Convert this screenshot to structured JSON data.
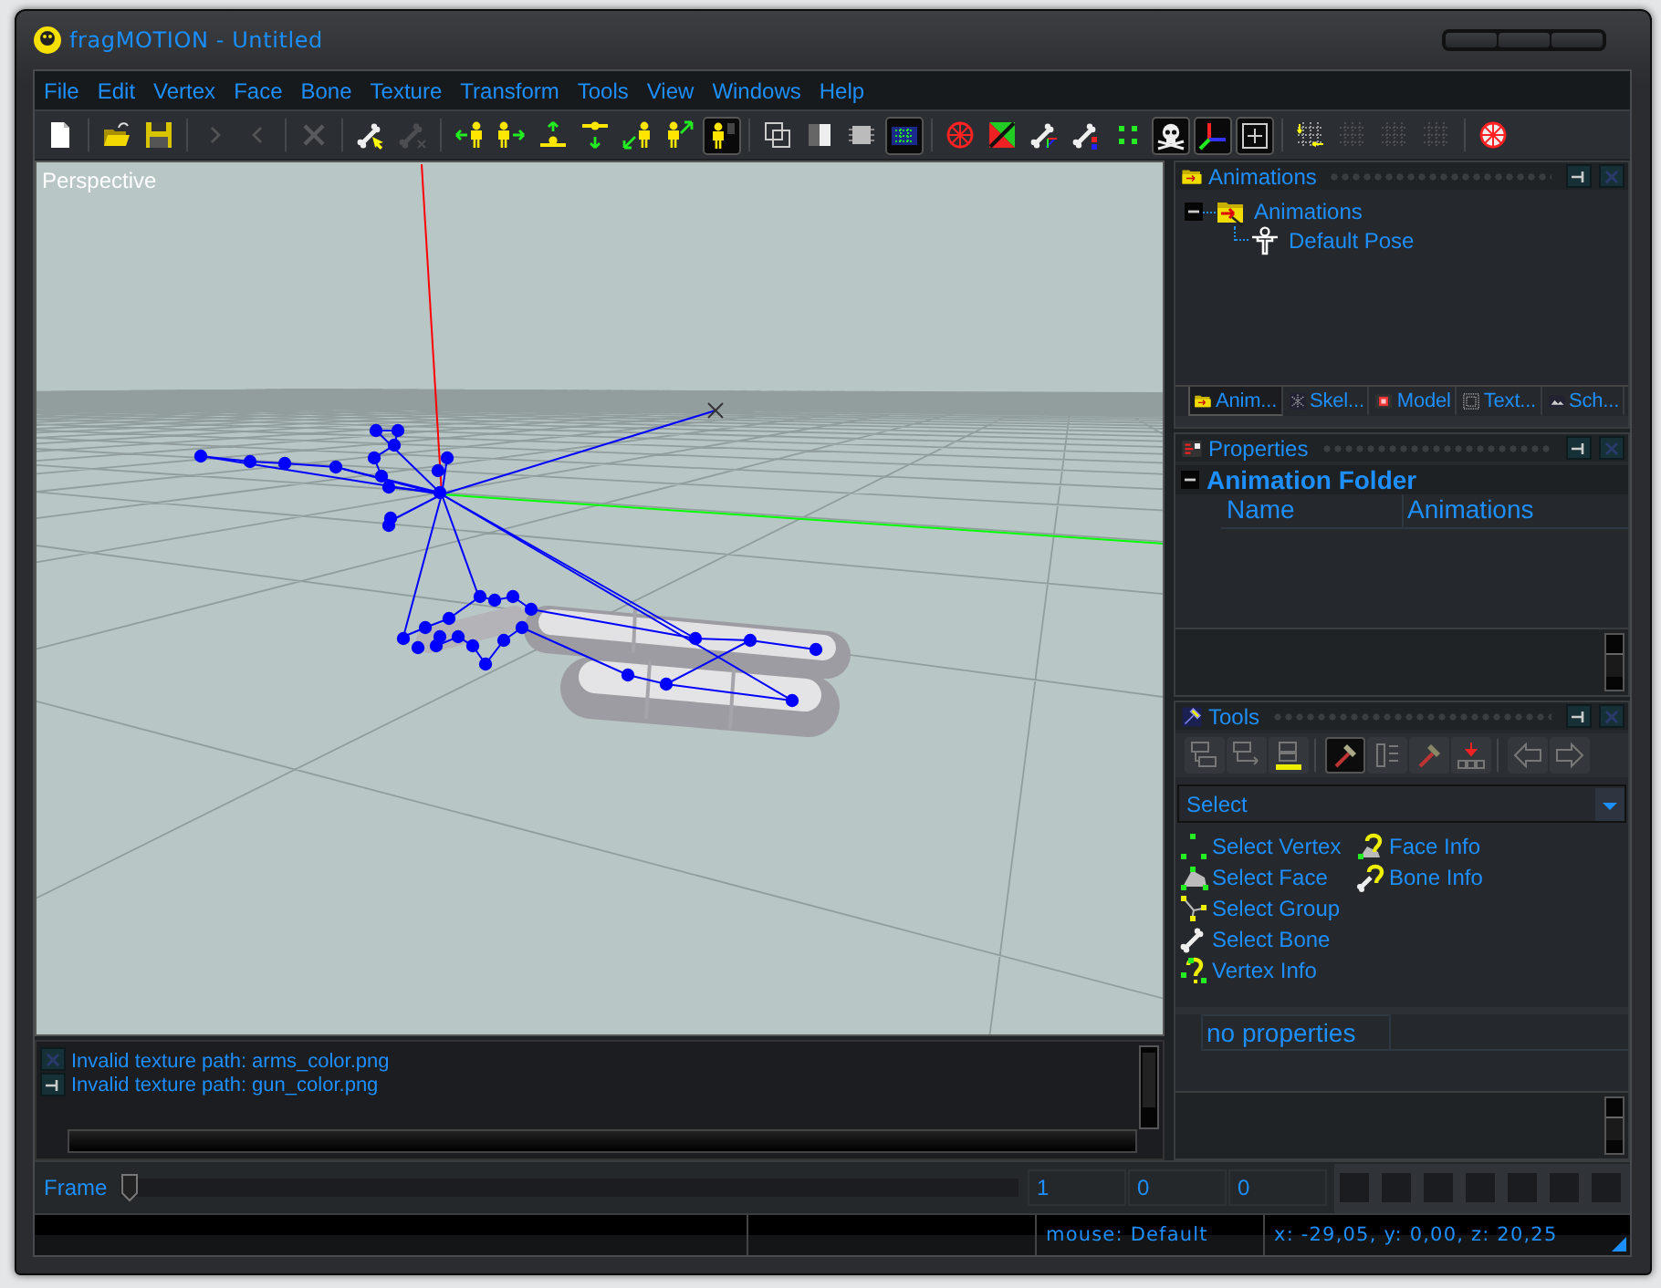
{
  "window": {
    "title": "fragMOTION - Untitled"
  },
  "menu": [
    "File",
    "Edit",
    "Vertex",
    "Face",
    "Bone",
    "Texture",
    "Transform",
    "Tools",
    "View",
    "Windows",
    "Help"
  ],
  "toolbar_groups": [
    [
      {
        "pressed": false,
        "disabled": false
      }
    ],
    [
      {
        "pressed": false,
        "disabled": false
      },
      {
        "pressed": false,
        "disabled": false
      }
    ],
    [
      {
        "pressed": false,
        "disabled": true
      },
      {
        "pressed": false,
        "disabled": true
      }
    ],
    [
      {
        "pressed": false,
        "disabled": true
      }
    ],
    [
      {
        "pressed": false,
        "disabled": false
      },
      {
        "pressed": false,
        "disabled": true
      }
    ],
    [
      {
        "pressed": false,
        "disabled": false
      },
      {
        "pressed": false,
        "disabled": false
      },
      {
        "pressed": false,
        "disabled": false
      },
      {
        "pressed": false,
        "disabled": false
      },
      {
        "pressed": false,
        "disabled": false
      },
      {
        "pressed": false,
        "disabled": false
      },
      {
        "pressed": true,
        "disabled": false
      }
    ],
    [
      {
        "pressed": false,
        "disabled": false
      },
      {
        "pressed": false,
        "disabled": false
      },
      {
        "pressed": false,
        "disabled": false
      },
      {
        "pressed": true,
        "disabled": false
      }
    ],
    [
      {
        "pressed": false,
        "disabled": false
      },
      {
        "pressed": false,
        "disabled": false
      },
      {
        "pressed": false,
        "disabled": false
      },
      {
        "pressed": false,
        "disabled": false
      },
      {
        "pressed": false,
        "disabled": false
      },
      {
        "pressed": true,
        "disabled": false
      },
      {
        "pressed": true,
        "disabled": false
      },
      {
        "pressed": true,
        "disabled": false
      }
    ],
    [
      {
        "pressed": false,
        "disabled": false
      },
      {
        "pressed": false,
        "disabled": true
      },
      {
        "pressed": false,
        "disabled": true
      },
      {
        "pressed": false,
        "disabled": true
      }
    ],
    [
      {
        "pressed": false,
        "disabled": false
      }
    ]
  ],
  "viewport": {
    "label": "Perspective"
  },
  "animations_panel": {
    "title": "Animations",
    "tree": [
      {
        "label": "Animations",
        "expanded": true,
        "children": [
          {
            "label": "Default Pose"
          }
        ]
      }
    ],
    "tabs": [
      {
        "label": "Anim...",
        "selected": true
      },
      {
        "label": "Skel...",
        "selected": false
      },
      {
        "label": "Model",
        "selected": false
      },
      {
        "label": "Text...",
        "selected": false
      },
      {
        "label": "Sch...",
        "selected": false
      }
    ]
  },
  "properties_panel": {
    "title": "Properties",
    "groups": [
      {
        "title": "Animation Folder",
        "expanded": true,
        "rows": [
          {
            "name": "Name",
            "value": "Animations"
          }
        ]
      }
    ]
  },
  "tools_panel": {
    "title": "Tools",
    "tool_buttons": [
      {
        "pressed": false
      },
      {
        "pressed": false
      },
      {
        "pressed": false
      },
      {
        "pressed": true
      },
      {
        "pressed": false
      },
      {
        "pressed": false
      },
      {
        "pressed": false
      },
      {
        "pressed": false
      },
      {
        "pressed": false
      }
    ],
    "mode": "Select",
    "tools": [
      "Select Vertex",
      "Select Face",
      "Select Group",
      "Select Bone",
      "Vertex Info",
      "Face Info",
      "Bone Info"
    ],
    "properties_text": "no properties"
  },
  "log": {
    "lines": [
      "Invalid texture path: arms_color.png",
      "Invalid texture path: gun_color.png"
    ]
  },
  "frame_bar": {
    "label": "Frame",
    "level": 0,
    "fields": [
      "1",
      "0",
      "0"
    ]
  },
  "status_bar": {
    "mouse": "mouse: Default",
    "coordinates": "x: -29,05, y: 0,00, z: 20,25"
  }
}
